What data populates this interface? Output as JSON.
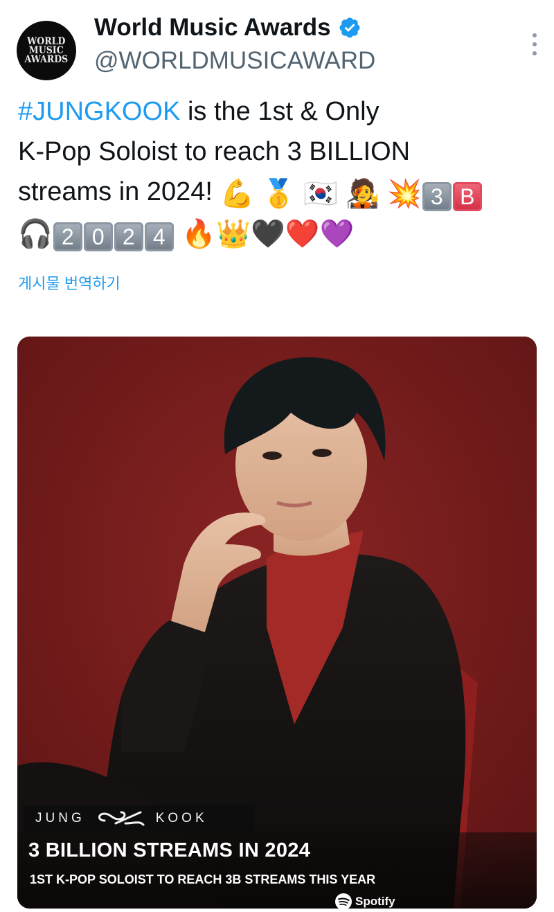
{
  "account": {
    "display_name": "World Music Awards",
    "handle": "@WORLDMUSICAWARD",
    "avatar_logo_lines": [
      "WORLD",
      "MUSIC",
      "AWARDS"
    ],
    "verified_icon": "verified-badge-icon",
    "more_icon": "more-options-icon"
  },
  "tweet": {
    "hashtag": "#JUNGKOOK",
    "line1_rest": " is the 1st & Only",
    "line2": "K-Pop Soloist to reach 3 BILLION",
    "line3": "streams in 2024! ",
    "emojis_line3": [
      "💪",
      "🥇",
      "🇰🇷",
      "🧑‍🎤",
      "💥"
    ],
    "keycaps_line3": [
      "3",
      "B"
    ],
    "emojis_line4_start": [
      "🎧"
    ],
    "keycaps_line4": [
      "2",
      "0",
      "2",
      "4"
    ],
    "emojis_line4_end": [
      "🔥",
      "👑",
      "🖤",
      "❤️",
      "💜"
    ],
    "translate_label": "게시물 번역하기"
  },
  "media": {
    "caption_name_left": "JUNG",
    "caption_name_right": "KOOK",
    "headline": "3 BILLION STREAMS IN 2024",
    "subline": "1ST K-POP SOLOIST TO REACH 3B STREAMS THIS YEAR",
    "brand": "Spotify",
    "colors": {
      "background": "#7a1a1a",
      "accent_blue": "#1d9bf0"
    }
  }
}
